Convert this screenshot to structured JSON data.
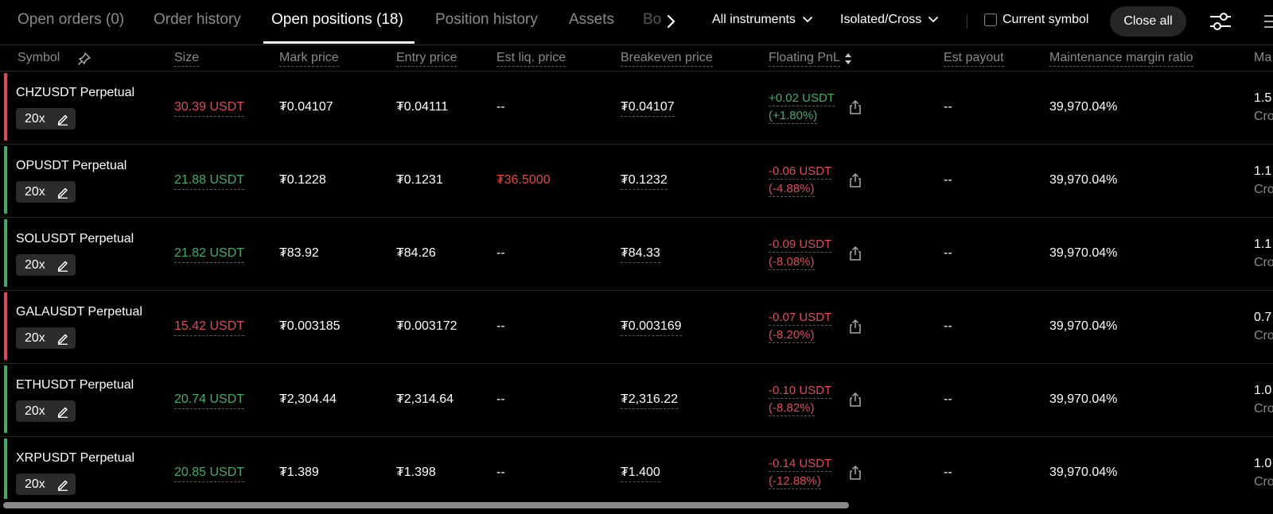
{
  "tabs": [
    {
      "label": "Open orders (0)"
    },
    {
      "label": "Order history"
    },
    {
      "label": "Open positions (18)"
    },
    {
      "label": "Position history"
    },
    {
      "label": "Assets"
    },
    {
      "label": "Bo"
    }
  ],
  "filters": {
    "instruments": "All instruments",
    "margin_mode": "Isolated/Cross",
    "current_symbol": "Current symbol",
    "close_all": "Close all"
  },
  "columns": {
    "symbol": "Symbol",
    "size": "Size",
    "mark_price": "Mark price",
    "entry_price": "Entry price",
    "est_liq_price": "Est liq. price",
    "breakeven_price": "Breakeven price",
    "floating_pnl": "Floating PnL",
    "est_payout": "Est payout",
    "maintenance_margin_ratio": "Maintenance margin ratio",
    "margin_clip": "Ma"
  },
  "colors": {
    "positive": "#3dae6a",
    "negative": "#e0485f",
    "liq_price": "#e04a3a"
  },
  "rows": [
    {
      "symbol": "CHZUSDT Perpetual",
      "leverage": "20x",
      "side": "short",
      "size": "30.39 USDT",
      "mark_price": "₮0.04107",
      "entry_price": "₮0.04111",
      "est_liq_price": "--",
      "breakeven_price": "₮0.04107",
      "pnl": "+0.02 USDT",
      "pnl_pct": "(+1.80%)",
      "pnl_sign": "pos",
      "est_payout": "--",
      "mmr": "39,970.04%",
      "margin": "1.5",
      "margin_mode": "Cro"
    },
    {
      "symbol": "OPUSDT Perpetual",
      "leverage": "20x",
      "side": "long",
      "size": "21.88 USDT",
      "mark_price": "₮0.1228",
      "entry_price": "₮0.1231",
      "est_liq_price": "₮36.5000",
      "breakeven_price": "₮0.1232",
      "pnl": "-0.06 USDT",
      "pnl_pct": "(-4.88%)",
      "pnl_sign": "neg",
      "est_payout": "--",
      "mmr": "39,970.04%",
      "margin": "1.1",
      "margin_mode": "Cro"
    },
    {
      "symbol": "SOLUSDT Perpetual",
      "leverage": "20x",
      "side": "long",
      "size": "21.82 USDT",
      "mark_price": "₮83.92",
      "entry_price": "₮84.26",
      "est_liq_price": "--",
      "breakeven_price": "₮84.33",
      "pnl": "-0.09 USDT",
      "pnl_pct": "(-8.08%)",
      "pnl_sign": "neg",
      "est_payout": "--",
      "mmr": "39,970.04%",
      "margin": "1.1",
      "margin_mode": "Cro"
    },
    {
      "symbol": "GALAUSDT Perpetual",
      "leverage": "20x",
      "side": "short",
      "size": "15.42 USDT",
      "mark_price": "₮0.003185",
      "entry_price": "₮0.003172",
      "est_liq_price": "--",
      "breakeven_price": "₮0.003169",
      "pnl": "-0.07 USDT",
      "pnl_pct": "(-8.20%)",
      "pnl_sign": "neg",
      "est_payout": "--",
      "mmr": "39,970.04%",
      "margin": "0.7",
      "margin_mode": "Cro"
    },
    {
      "symbol": "ETHUSDT Perpetual",
      "leverage": "20x",
      "side": "long",
      "size": "20.74 USDT",
      "mark_price": "₮2,304.44",
      "entry_price": "₮2,314.64",
      "est_liq_price": "--",
      "breakeven_price": "₮2,316.22",
      "pnl": "-0.10 USDT",
      "pnl_pct": "(-8.82%)",
      "pnl_sign": "neg",
      "est_payout": "--",
      "mmr": "39,970.04%",
      "margin": "1.0",
      "margin_mode": "Cro"
    },
    {
      "symbol": "XRPUSDT Perpetual",
      "leverage": "20x",
      "side": "long",
      "size": "20.85 USDT",
      "mark_price": "₮1.389",
      "entry_price": "₮1.398",
      "est_liq_price": "--",
      "breakeven_price": "₮1.400",
      "pnl": "-0.14 USDT",
      "pnl_pct": "(-12.88%)",
      "pnl_sign": "neg",
      "est_payout": "--",
      "mmr": "39,970.04%",
      "margin": "1.0",
      "margin_mode": "Cro"
    }
  ]
}
